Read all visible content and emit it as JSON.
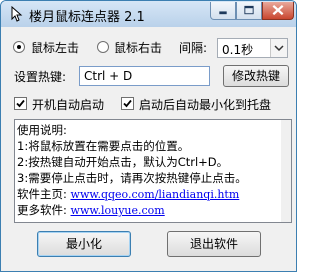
{
  "window": {
    "title": "楼月鼠标连点器 2.1"
  },
  "mouse_button": {
    "options": [
      "鼠标左击",
      "鼠标右击"
    ],
    "selected_index": 0
  },
  "interval": {
    "label": "间隔:",
    "value": "0.1秒"
  },
  "hotkey": {
    "label": "设置热键:",
    "value": "Ctrl + D",
    "modify_button": "修改热键"
  },
  "options": [
    {
      "label": "开机自动启动",
      "checked": true
    },
    {
      "label": "启动后自动最小化到托盘",
      "checked": true
    }
  ],
  "instructions": {
    "heading": "使用说明:",
    "lines": [
      "1:将鼠标放置在需要点击的位置。",
      "2:按热键自动开始点击，默认为Ctrl+D。",
      "3:需要停止点击时，请再次按热键停止点击。"
    ],
    "homepage_label": "软件主页:",
    "homepage_url": "www.qqeo.com/liandianqi.htm",
    "more_label": "更多软件:",
    "more_url": "www.louyue.com"
  },
  "footer": {
    "minimize_button": "最小化",
    "exit_button": "退出软件"
  },
  "colors": {
    "title_bar": "#b9d1ea",
    "close_button": "#c9462f",
    "link": "#0000ee"
  }
}
